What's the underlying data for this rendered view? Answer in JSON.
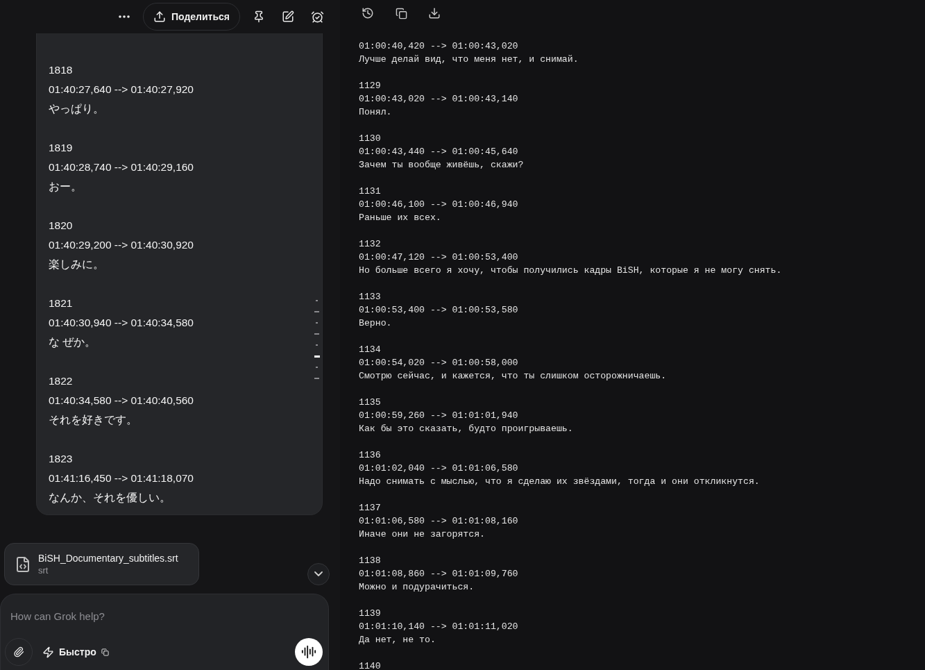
{
  "chat": {
    "share_label": "Поделиться",
    "entries": [
      {
        "number": "1818",
        "time": "01:40:27,640 --> 01:40:27,920",
        "text": "やっぱり。"
      },
      {
        "number": "1819",
        "time": "01:40:28,740 --> 01:40:29,160",
        "text": "おー。"
      },
      {
        "number": "1820",
        "time": "01:40:29,200 --> 01:40:30,920",
        "text": "楽しみに。"
      },
      {
        "number": "1821",
        "time": "01:40:30,940 --> 01:40:34,580",
        "text": "な ぜか。"
      },
      {
        "number": "1822",
        "time": "01:40:34,580 --> 01:40:40,560",
        "text": "それを好きです。"
      },
      {
        "number": "1823",
        "time": "01:41:16,450 --> 01:41:18,070",
        "text": "なんか、それを優しい。"
      }
    ],
    "file": {
      "name": "BiSH_Documentary_subtitles.srt",
      "type": "srt"
    },
    "composer": {
      "placeholder": "How can Grok help?",
      "mode": "Быстро"
    }
  },
  "document": {
    "entries": [
      {
        "time": "01:00:40,420 --> 01:00:43,020",
        "text": "Лучше делай вид, что меня нет, и снимай."
      },
      {
        "number": "1129",
        "time": "01:00:43,020 --> 01:00:43,140",
        "text": "Понял."
      },
      {
        "number": "1130",
        "time": "01:00:43,440 --> 01:00:45,640",
        "text": "Зачем ты вообще живёшь, скажи?"
      },
      {
        "number": "1131",
        "time": "01:00:46,100 --> 01:00:46,940",
        "text": "Раньше их всех."
      },
      {
        "number": "1132",
        "time": "01:00:47,120 --> 01:00:53,400",
        "text": "Но больше всего я хочу, чтобы получились кадры BiSH, которые я не могу снять."
      },
      {
        "number": "1133",
        "time": "01:00:53,400 --> 01:00:53,580",
        "text": "Верно."
      },
      {
        "number": "1134",
        "time": "01:00:54,020 --> 01:00:58,000",
        "text": "Смотрю сейчас, и кажется, что ты слишком осторожничаешь."
      },
      {
        "number": "1135",
        "time": "01:00:59,260 --> 01:01:01,940",
        "text": "Как бы это сказать, будто проигрываешь."
      },
      {
        "number": "1136",
        "time": "01:01:02,040 --> 01:01:06,580",
        "text": "Надо снимать с мыслью, что я сделаю их звёздами, тогда и они откликнутся."
      },
      {
        "number": "1137",
        "time": "01:01:06,580 --> 01:01:08,160",
        "text": "Иначе они не загорятся."
      },
      {
        "number": "1138",
        "time": "01:01:08,860 --> 01:01:09,760",
        "text": "Можно и подурачиться."
      },
      {
        "number": "1139",
        "time": "01:01:10,140 --> 01:01:11,020",
        "text": "Да нет, не то."
      },
      {
        "number": "1140"
      }
    ]
  }
}
